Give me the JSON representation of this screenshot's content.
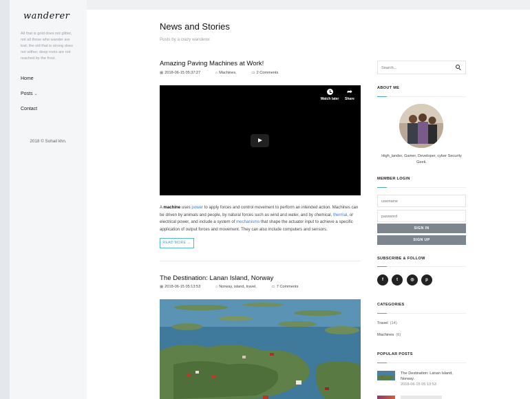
{
  "site": {
    "logo": "wanderer",
    "tagline": "All that is gold does not glitter, not all those who wander are lost; the old that is strong does not wither, deep roots are not reached by the frost.",
    "copyright": "2018 © Sohail khn."
  },
  "nav": {
    "items": [
      {
        "label": "Home"
      },
      {
        "label": "Posts",
        "has_caret": true
      },
      {
        "label": "Contact"
      }
    ]
  },
  "header": {
    "title": "News and Stories",
    "subtitle": "Posts by a crazy wanderer."
  },
  "posts": [
    {
      "title": "Amazing Paving Machines at Work!",
      "date": "2018-06-15 05:37:27",
      "tags": "Machines,",
      "comments": "2 Comments",
      "video": {
        "watch_later": "Watch later",
        "share": "Share"
      },
      "excerpt": {
        "p1": "A ",
        "b1": "machine",
        "p2": " uses ",
        "l1": "power",
        "p3": " to apply forces and control movement to perform an intended action. Machines can be driven by animals and people, by natural forces such as wind and water, and by chemical, ",
        "l2": "thermal",
        "p4": ", or electrical power, and include a system of ",
        "l3": "mechanisms",
        "p5": " that shape the actuator input to achieve a specific application of output forces and movement. They can also include computers and sensors."
      },
      "read_more": "READ MORE →"
    },
    {
      "title": "The Destination: Lanan Island, Norway",
      "date": "2018-06-15 05:13:53",
      "tags": "Norway, island, travel,",
      "comments": "7 Comments"
    }
  ],
  "sidebar": {
    "search_placeholder": "Search...",
    "about": {
      "title": "ABOUT ME",
      "bio": "High_lander, Gamer, Developer, cyber Security Geek."
    },
    "login": {
      "title": "MEMBER LOGIN",
      "username_placeholder": "username",
      "password_placeholder": "password",
      "sign_in": "SIGN IN",
      "sign_up": "SIGN UP"
    },
    "follow": {
      "title": "SUBSCRIBE & FOLLOW",
      "icons": [
        "f",
        "t",
        "◎",
        "p"
      ]
    },
    "categories": {
      "title": "CATEGORIES",
      "items": [
        {
          "name": "Travel",
          "count": "(14)"
        },
        {
          "name": "Machines",
          "count": "(6)"
        }
      ]
    },
    "popular": {
      "title": "POPULAR POSTS",
      "items": [
        {
          "title": "The Destination: Lanan Island, Norway.",
          "date": "2018-06-15 05:13:53"
        }
      ]
    }
  },
  "colors": {
    "accent": "#4aa4cc",
    "link": "#3a7bd5",
    "button": "#7d858e"
  }
}
